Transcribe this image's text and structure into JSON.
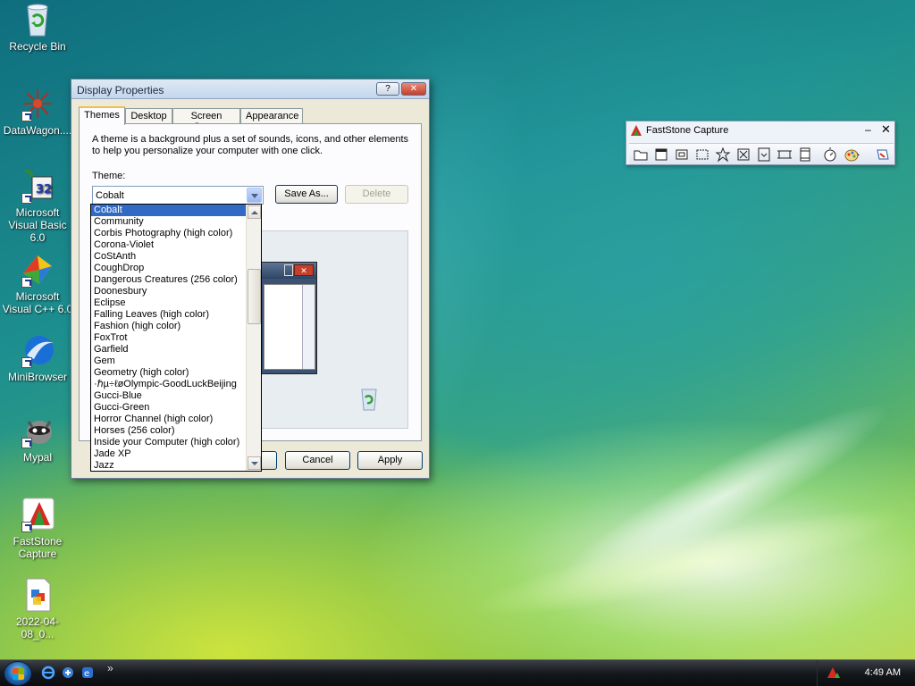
{
  "desktop": {
    "icons": [
      {
        "label": "Recycle Bin",
        "icon": "recycle-bin-icon"
      },
      {
        "label": "DataWagon....",
        "icon": "datawagon-icon"
      },
      {
        "label": "Microsoft\nVisual Basic 6.0",
        "icon": "visual-basic-icon"
      },
      {
        "label": "Microsoft\nVisual C++ 6.0",
        "icon": "visual-cpp-icon"
      },
      {
        "label": "MiniBrowser",
        "icon": "minibrowser-icon"
      },
      {
        "label": "Mypal",
        "icon": "mypal-icon"
      },
      {
        "label": "FastStone\nCapture",
        "icon": "faststone-icon"
      },
      {
        "label": "2022-04-08_0...",
        "icon": "image-file-icon"
      }
    ]
  },
  "dialog": {
    "title": "Display Properties",
    "help_label": "?",
    "close_label": "✕",
    "tabs": [
      "Themes",
      "Desktop",
      "Screen Saver",
      "Appearance"
    ],
    "description": "A theme is a background plus a set of sounds, icons, and other elements to help you personalize your computer with one click.",
    "theme_label": "Theme:",
    "theme_value": "Cobalt",
    "save_as_label": "Save As...",
    "delete_label": "Delete",
    "cancel_label": "Cancel",
    "apply_label": "Apply",
    "theme_options": [
      "Cobalt",
      "Community",
      "Corbis Photography (high color)",
      "Corona-Violet",
      "CoStAnth",
      "CoughDrop",
      "Dangerous Creatures (256 color)",
      "Doonesbury",
      "Eclipse",
      "Falling Leaves (high color)",
      "Fashion (high color)",
      "FoxTrot",
      "Garfield",
      "Gem",
      "Geometry (high color)",
      "·ℏµ÷ℓøOlympic-GoodLuckBeijing",
      "Gucci-Blue",
      "Gucci-Green",
      "Horror Channel (high color)",
      "Horses (256 color)",
      "Inside your Computer (high color)",
      "Jade XP",
      "Jazz"
    ],
    "selected_option": 0
  },
  "faststone": {
    "title": "FastStone Capture",
    "minimize_label": "–",
    "close_label": "✕",
    "tools": [
      "open-folder-icon",
      "capture-window-icon",
      "capture-object-icon",
      "capture-rectangle-icon",
      "capture-freehand-icon",
      "capture-fullscreen-icon",
      "capture-scrolling-icon",
      "capture-fixed-region-icon",
      "screen-recorder-icon",
      "delay-timer-icon",
      "color-picker-icon",
      "settings-icon"
    ]
  },
  "taskbar": {
    "clock": "4:49 AM",
    "more_label": "»"
  },
  "colors": {
    "selection": "#316ac5",
    "dialog_bg": "#ece9d8",
    "close_red": "#c4402a"
  }
}
